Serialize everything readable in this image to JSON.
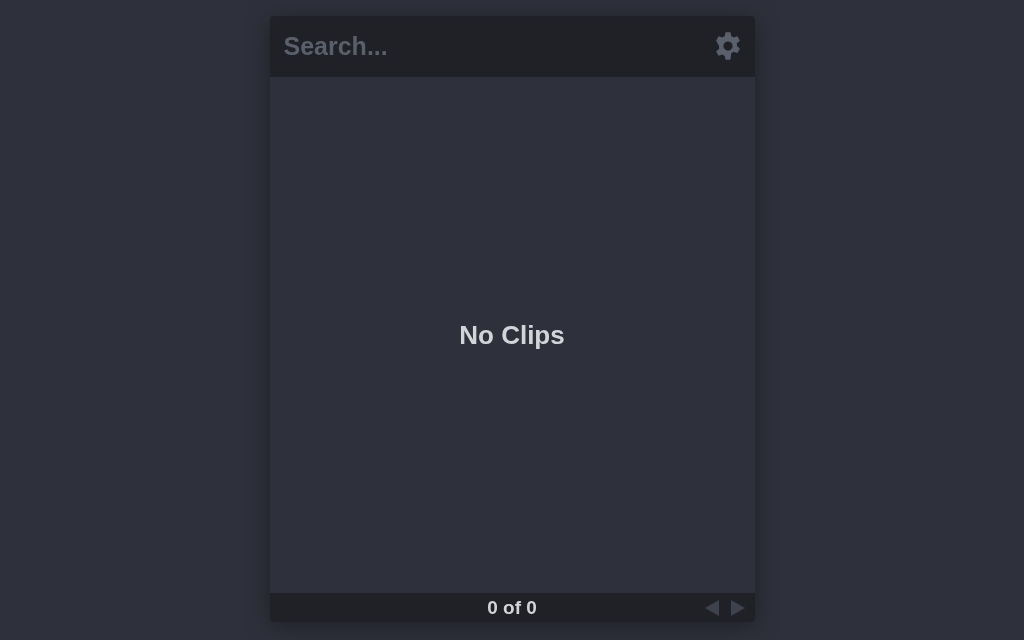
{
  "search": {
    "placeholder": "Search..."
  },
  "content": {
    "empty_message": "No Clips"
  },
  "footer": {
    "counter": "0 of 0"
  }
}
